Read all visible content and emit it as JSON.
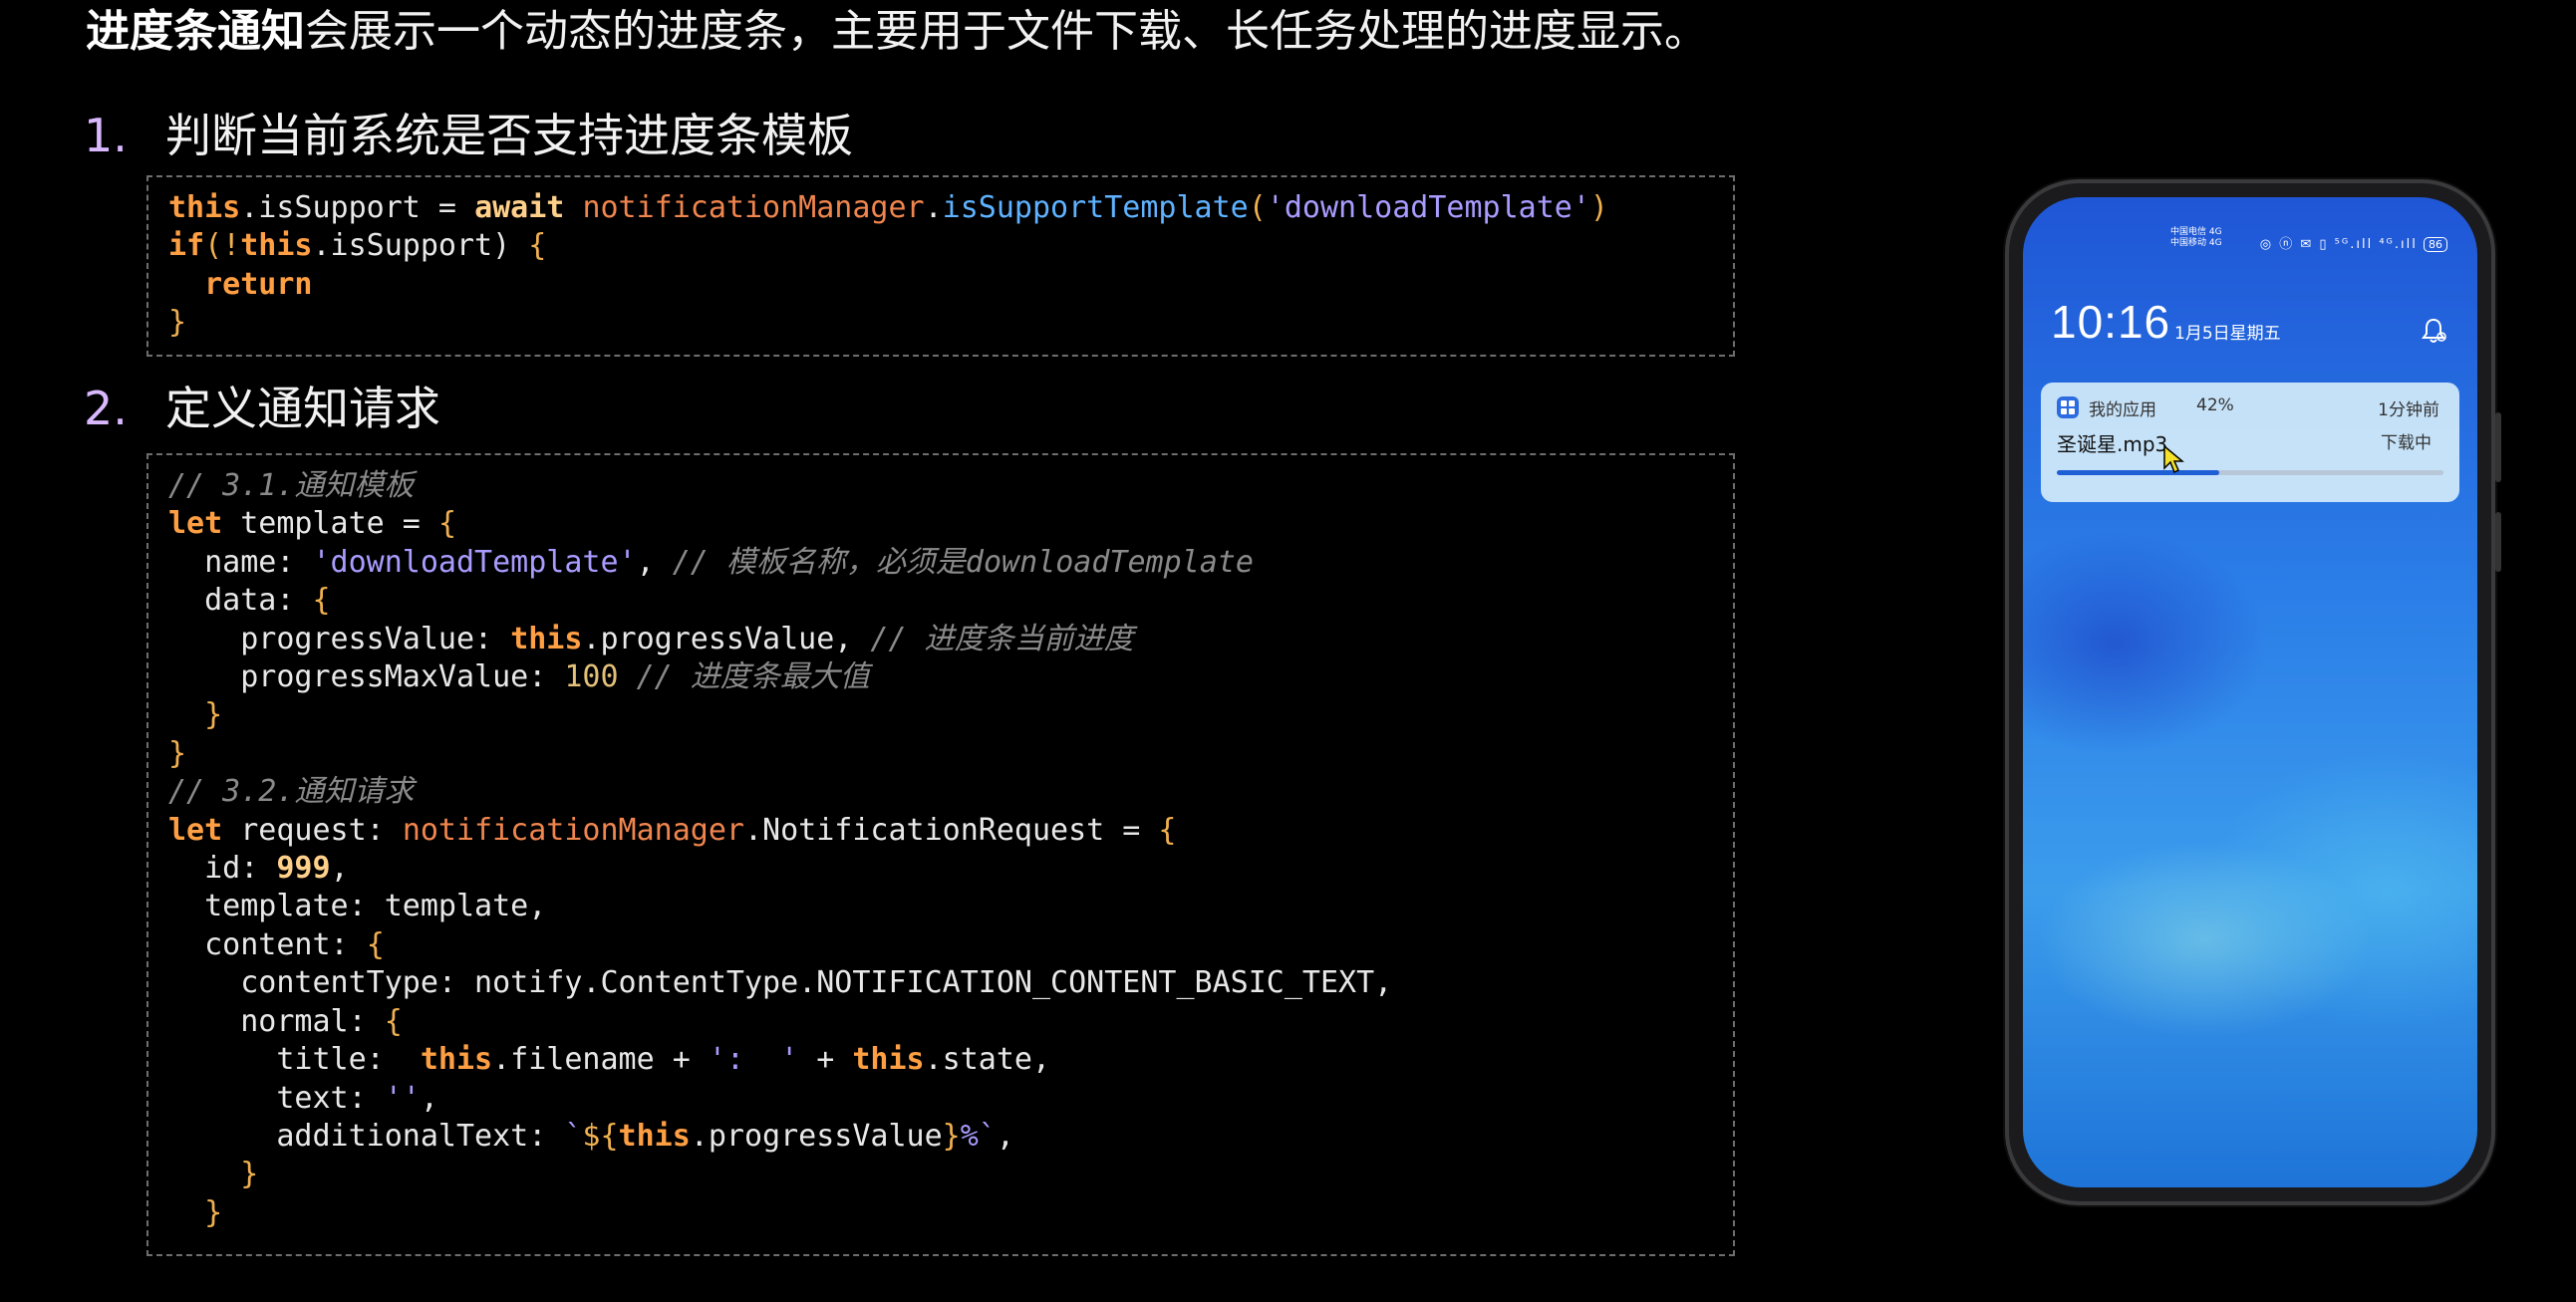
{
  "intro": {
    "bold": "进度条通知",
    "rest": "会展示一个动态的进度条，主要用于文件下载、长任务处理的进度显示。"
  },
  "steps": [
    {
      "num": "1.",
      "label": "判断当前系统是否支持进度条模板"
    },
    {
      "num": "2.",
      "label": "定义通知请求"
    }
  ],
  "code1": {
    "this": "this",
    "prop_isSupport": ".isSupport = ",
    "await": "await",
    "obj": "notificationManager",
    "dot": ".",
    "fn": "isSupportTemplate",
    "paren_open": "(",
    "str": "'downloadTemplate'",
    "paren_close": ")",
    "if": "if",
    "if_open": "(!",
    "this2": "this",
    "if_rest": ".isSupport) ",
    "brace_open": "{",
    "return": "return",
    "brace_close": "}"
  },
  "code2": {
    "c1": "// 3.1.通知模板",
    "let": "let",
    "template_decl": " template = ",
    "brace": "{",
    "name_key": "name: ",
    "name_val": "'downloadTemplate'",
    "comma": ", ",
    "c2": "// 模板名称，必须是downloadTemplate",
    "data_key": "data: ",
    "pv_key": "progressValue: ",
    "this": "this",
    "pv_val": ".progressValue, ",
    "c3": "// 进度条当前进度",
    "pmv_key": "progressMaxValue: ",
    "pmv_val": "100",
    "c4": "// 进度条最大值",
    "brace_close": "}",
    "c5": "// 3.2.通知请求",
    "let2": "let",
    "req_decl": " request: ",
    "req_obj": "notificationManager",
    "req_type": ".NotificationRequest = ",
    "id_key": "id: ",
    "id_val": "999",
    "id_comma": ",",
    "tpl_line": "template: template,",
    "content_key": "content: ",
    "ct_line": "contentType: notify.ContentType.NOTIFICATION_CONTENT_BASIC_TEXT,",
    "normal_key": "normal: ",
    "title_key": "title:  ",
    "title_mid": ".filename + ",
    "title_str": "':  '",
    "title_plus": " + ",
    "title_end": ".state,",
    "text_key": "text: ",
    "text_val": "''",
    "text_comma": ",",
    "add_key": "additionalText: ",
    "add_tick": "`",
    "add_open": "${",
    "add_mid": ".progressValue",
    "add_close": "}",
    "add_end": "%`",
    "add_comma": ","
  },
  "phone": {
    "carrier_1": "中国电信 4G",
    "carrier_2": "中国移动 4G",
    "status_icons": "◎ ⓝ ✉ ▯ ⁵ᴳ.ıll ⁴ᴳ.ıll",
    "battery": "86",
    "clock": "10:16",
    "date": "1月5日星期五",
    "notification": {
      "app_name": "我的应用",
      "progress_text": "42%",
      "time_ago": "1分钟前",
      "title": "圣诞星.mp3",
      "state": "下载中",
      "progress": 0.42
    }
  },
  "colors": {
    "keyword": "#ff9f43",
    "string": "#a99cff",
    "function": "#5eb2ff",
    "comment": "#8a8a8a",
    "progress_fill": "#1f5fd6"
  }
}
